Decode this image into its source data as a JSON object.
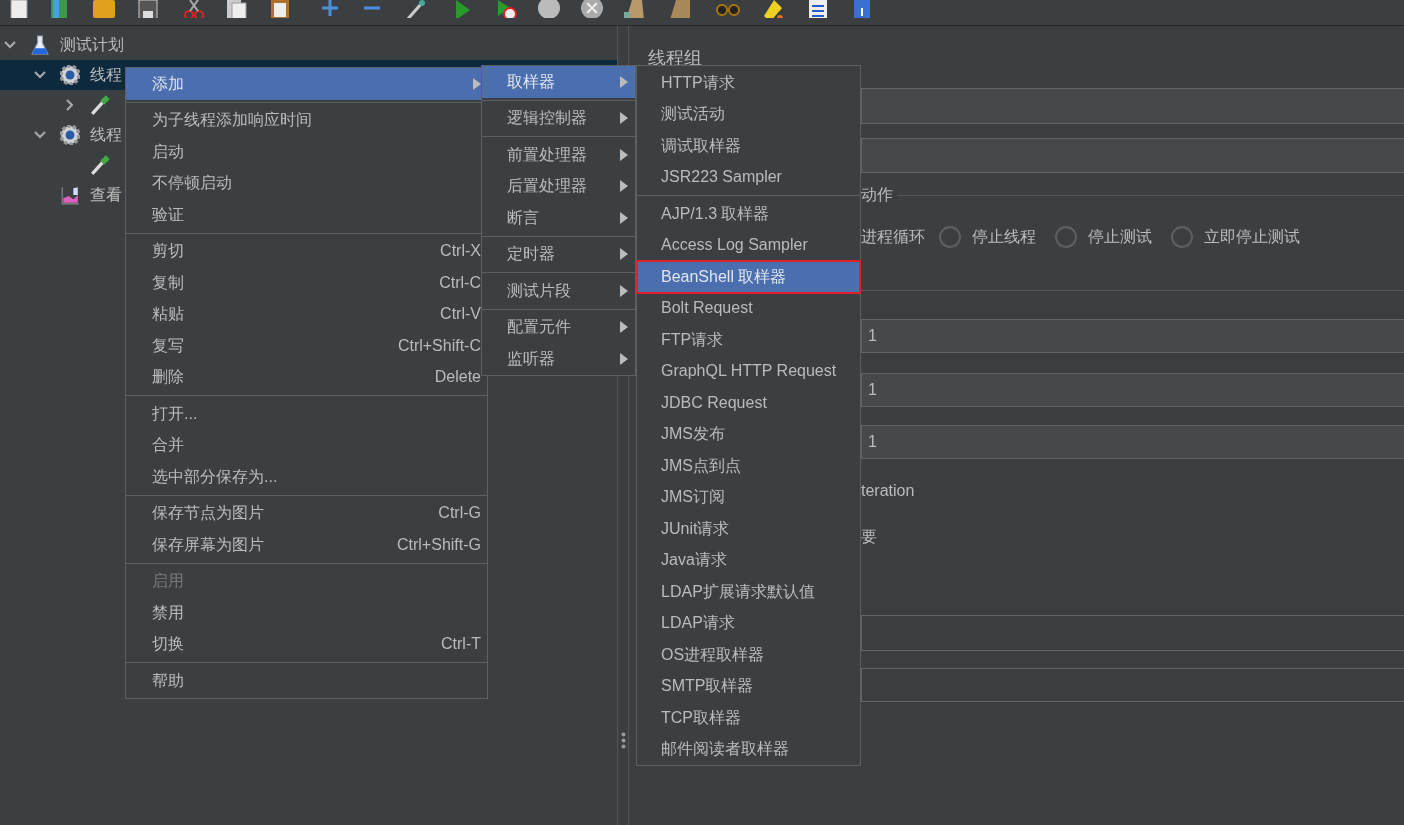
{
  "tree": [
    {
      "label": "测试计划",
      "expanded": true,
      "selected": false,
      "kind": "plan",
      "children": [
        {
          "label": "线程",
          "expanded": true,
          "selected": true,
          "kind": "thread_group",
          "children": [
            {
              "expanded": false,
              "selected": false,
              "kind": "sampler"
            }
          ]
        },
        {
          "label": "线程",
          "expanded": true,
          "selected": false,
          "kind": "thread_group",
          "children": [
            {
              "selected": false,
              "kind": "sampler"
            }
          ]
        },
        {
          "label": "查看",
          "selected": false,
          "kind": "listener"
        }
      ]
    }
  ],
  "context_menu": {
    "items": [
      {
        "kind": "item",
        "label": "添加",
        "submenu": true,
        "selected": true,
        "disabled": false
      },
      {
        "kind": "separator"
      },
      {
        "kind": "item",
        "label": "为子线程添加响应时间",
        "selected": false,
        "disabled": false
      },
      {
        "kind": "item",
        "label": "启动",
        "selected": false,
        "disabled": false
      },
      {
        "kind": "item",
        "label": "不停顿启动",
        "selected": false,
        "disabled": false
      },
      {
        "kind": "item",
        "label": "验证",
        "selected": false,
        "disabled": false
      },
      {
        "kind": "separator"
      },
      {
        "kind": "item",
        "label": "剪切",
        "shortcut": "Ctrl-X",
        "selected": false,
        "disabled": false
      },
      {
        "kind": "item",
        "label": "复制",
        "shortcut": "Ctrl-C",
        "selected": false,
        "disabled": false
      },
      {
        "kind": "item",
        "label": "粘贴",
        "shortcut": "Ctrl-V",
        "selected": false,
        "disabled": false
      },
      {
        "kind": "item",
        "label": "复写",
        "shortcut": "Ctrl+Shift-C",
        "selected": false,
        "disabled": false
      },
      {
        "kind": "item",
        "label": "删除",
        "shortcut": "Delete",
        "selected": false,
        "disabled": false
      },
      {
        "kind": "separator"
      },
      {
        "kind": "item",
        "label": "打开...",
        "selected": false,
        "disabled": false
      },
      {
        "kind": "item",
        "label": "合并",
        "selected": false,
        "disabled": false
      },
      {
        "kind": "item",
        "label": "选中部分保存为...",
        "selected": false,
        "disabled": false
      },
      {
        "kind": "separator"
      },
      {
        "kind": "item",
        "label": "保存节点为图片",
        "shortcut": "Ctrl-G",
        "selected": false,
        "disabled": false
      },
      {
        "kind": "item",
        "label": "保存屏幕为图片",
        "shortcut": "Ctrl+Shift-G",
        "selected": false,
        "disabled": false
      },
      {
        "kind": "separator"
      },
      {
        "kind": "item",
        "label": "启用",
        "selected": false,
        "disabled": true
      },
      {
        "kind": "item",
        "label": "禁用",
        "selected": false,
        "disabled": false
      },
      {
        "kind": "item",
        "label": "切换",
        "shortcut": "Ctrl-T",
        "selected": false,
        "disabled": false
      },
      {
        "kind": "separator"
      },
      {
        "kind": "item",
        "label": "帮助",
        "selected": false,
        "disabled": false
      }
    ]
  },
  "add_submenu": {
    "items": [
      {
        "kind": "item",
        "label": "取样器",
        "submenu": true,
        "selected": true
      },
      {
        "kind": "separator"
      },
      {
        "kind": "item",
        "label": "逻辑控制器",
        "submenu": true,
        "selected": false
      },
      {
        "kind": "separator"
      },
      {
        "kind": "item",
        "label": "前置处理器",
        "submenu": true,
        "selected": false
      },
      {
        "kind": "item",
        "label": "后置处理器",
        "submenu": true,
        "selected": false
      },
      {
        "kind": "item",
        "label": "断言",
        "submenu": true,
        "selected": false
      },
      {
        "kind": "separator"
      },
      {
        "kind": "item",
        "label": "定时器",
        "submenu": true,
        "selected": false
      },
      {
        "kind": "separator"
      },
      {
        "kind": "item",
        "label": "测试片段",
        "submenu": true,
        "selected": false
      },
      {
        "kind": "separator"
      },
      {
        "kind": "item",
        "label": "配置元件",
        "submenu": true,
        "selected": false
      },
      {
        "kind": "item",
        "label": "监听器",
        "submenu": true,
        "selected": false
      }
    ]
  },
  "sampler_submenu": {
    "items": [
      {
        "kind": "item",
        "label": "HTTP请求",
        "selected": false
      },
      {
        "kind": "item",
        "label": "测试活动",
        "selected": false
      },
      {
        "kind": "item",
        "label": "调试取样器",
        "selected": false
      },
      {
        "kind": "item",
        "label": "JSR223 Sampler",
        "selected": false
      },
      {
        "kind": "separator"
      },
      {
        "kind": "item",
        "label": "AJP/1.3 取样器",
        "selected": false
      },
      {
        "kind": "item",
        "label": "Access Log Sampler",
        "selected": false
      },
      {
        "kind": "item",
        "label": "BeanShell 取样器",
        "selected": true
      },
      {
        "kind": "item",
        "label": "Bolt Request",
        "selected": false
      },
      {
        "kind": "item",
        "label": "FTP请求",
        "selected": false
      },
      {
        "kind": "item",
        "label": "GraphQL HTTP Request",
        "selected": false
      },
      {
        "kind": "item",
        "label": "JDBC Request",
        "selected": false
      },
      {
        "kind": "item",
        "label": "JMS发布",
        "selected": false
      },
      {
        "kind": "item",
        "label": "JMS点到点",
        "selected": false
      },
      {
        "kind": "item",
        "label": "JMS订阅",
        "selected": false
      },
      {
        "kind": "item",
        "label": "JUnit请求",
        "selected": false
      },
      {
        "kind": "item",
        "label": "Java请求",
        "selected": false
      },
      {
        "kind": "item",
        "label": "LDAP扩展请求默认值",
        "selected": false
      },
      {
        "kind": "item",
        "label": "LDAP请求",
        "selected": false
      },
      {
        "kind": "item",
        "label": "OS进程取样器",
        "selected": false
      },
      {
        "kind": "item",
        "label": "SMTP取样器",
        "selected": false
      },
      {
        "kind": "item",
        "label": "TCP取样器",
        "selected": false
      },
      {
        "kind": "item",
        "label": "邮件阅读者取样器",
        "selected": false
      }
    ]
  },
  "panel": {
    "title": "线程组",
    "action_group": {
      "legend": "动作",
      "leading_label": "进程循环",
      "radios": [
        {
          "label": "停止线程",
          "selected": false
        },
        {
          "label": "停止测试",
          "selected": false
        },
        {
          "label": "立即停止测试",
          "selected": false
        }
      ]
    },
    "fields_middle": [
      {
        "value": "1"
      },
      {
        "value": "1"
      },
      {
        "value": "1"
      }
    ],
    "labels": [
      "teration",
      "要"
    ]
  }
}
